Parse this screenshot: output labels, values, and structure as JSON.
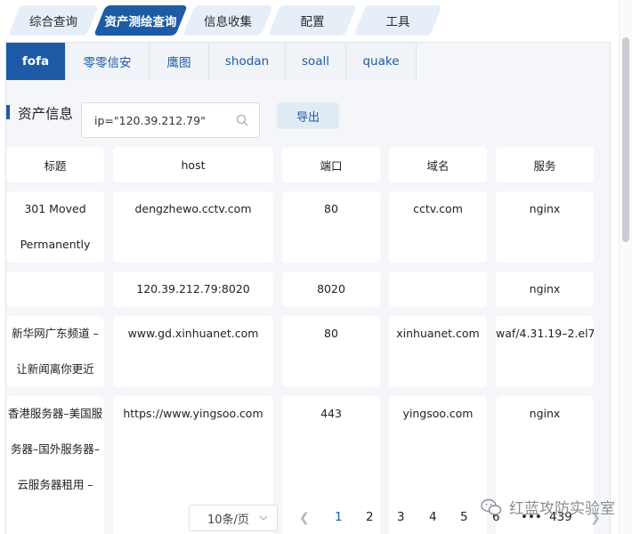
{
  "top_tabs": [
    {
      "label": "综合查询",
      "active": false
    },
    {
      "label": "资产测绘查询",
      "active": true
    },
    {
      "label": "信息收集",
      "active": false
    },
    {
      "label": "配置",
      "active": false
    },
    {
      "label": "工具",
      "active": false
    }
  ],
  "sub_tabs": [
    {
      "label": "fofa",
      "active": true
    },
    {
      "label": "零零信安",
      "active": false
    },
    {
      "label": "鹰图",
      "active": false
    },
    {
      "label": "shodan",
      "active": false
    },
    {
      "label": "soall",
      "active": false
    },
    {
      "label": "quake",
      "active": false
    }
  ],
  "section": {
    "title": "资产信息"
  },
  "search": {
    "value": "ip=\"120.39.212.79\""
  },
  "export_label": "导出",
  "table": {
    "headers": [
      "标题",
      "host",
      "端口",
      "域名",
      "服务"
    ],
    "rows": [
      {
        "title": [
          "301 Moved",
          "Permanently"
        ],
        "host": "dengzhewo.cctv.com",
        "port": "80",
        "domain": "cctv.com",
        "service": "nginx"
      },
      {
        "title": [],
        "host": "120.39.212.79:8020",
        "port": "8020",
        "domain": "",
        "service": "nginx"
      },
      {
        "title": [
          "新华网广东频道 –",
          "让新闻离你更近"
        ],
        "host": "www.gd.xinhuanet.com",
        "port": "80",
        "domain": "xinhuanet.com",
        "service": "waf/4.31.19–2.el7"
      },
      {
        "title": [
          "香港服务器–美国服",
          "务器–国外服务器–",
          "云服务器租用 –"
        ],
        "host": "https://www.yingsoo.com",
        "port": "443",
        "domain": "yingsoo.com",
        "service": "nginx"
      }
    ]
  },
  "pagination": {
    "page_size": "10条/页",
    "pages": [
      "1",
      "2",
      "3",
      "4",
      "5",
      "6",
      "•••",
      "439"
    ],
    "current": "1"
  },
  "watermark": {
    "text": "红蓝攻防实验室"
  },
  "colors": {
    "primary": "#1e5ba6",
    "tab_bg": "#e6eff8",
    "panel_bg": "#f4f6f9"
  }
}
